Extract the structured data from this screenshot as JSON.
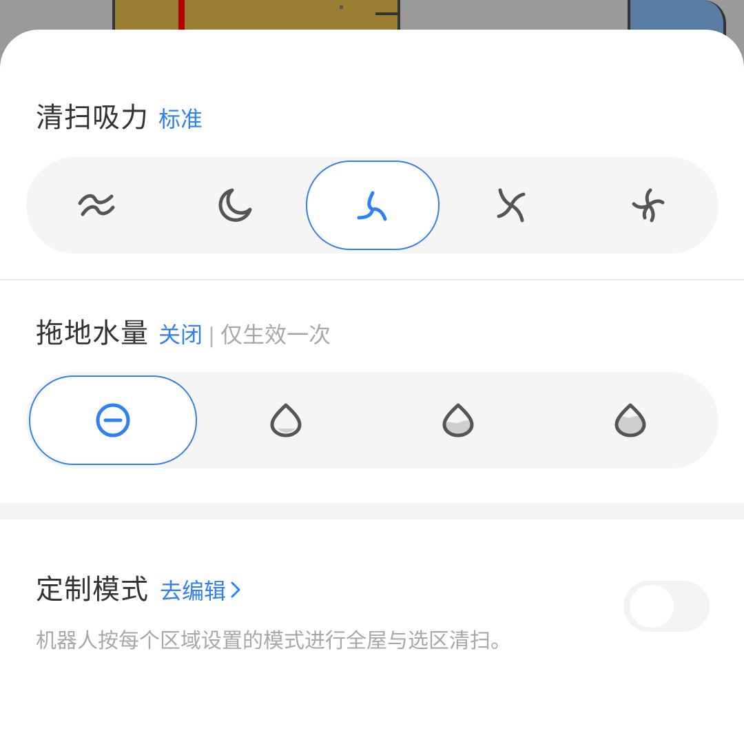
{
  "suction": {
    "title": "清扫吸力",
    "current": "标准",
    "options": [
      {
        "icon": "quiet-wave-icon",
        "selected": false
      },
      {
        "icon": "moon-icon",
        "selected": false
      },
      {
        "icon": "fan-standard-icon",
        "selected": true
      },
      {
        "icon": "fan-strong-icon",
        "selected": false
      },
      {
        "icon": "fan-max-icon",
        "selected": false
      }
    ]
  },
  "water": {
    "title": "拖地水量",
    "current": "关闭",
    "separator": "|",
    "note": "仅生效一次",
    "options": [
      {
        "icon": "water-off-icon",
        "selected": true
      },
      {
        "icon": "water-low-icon",
        "selected": false
      },
      {
        "icon": "water-medium-icon",
        "selected": false
      },
      {
        "icon": "water-high-icon",
        "selected": false
      }
    ]
  },
  "custom_mode": {
    "title": "定制模式",
    "edit_label": "去编辑",
    "description": "机器人按每个区域设置的模式进行全屋与选区清扫。",
    "enabled": false
  },
  "colors": {
    "accent": "#2f7ff5",
    "icon_gray": "#555555",
    "track": "#f5f5f5"
  }
}
